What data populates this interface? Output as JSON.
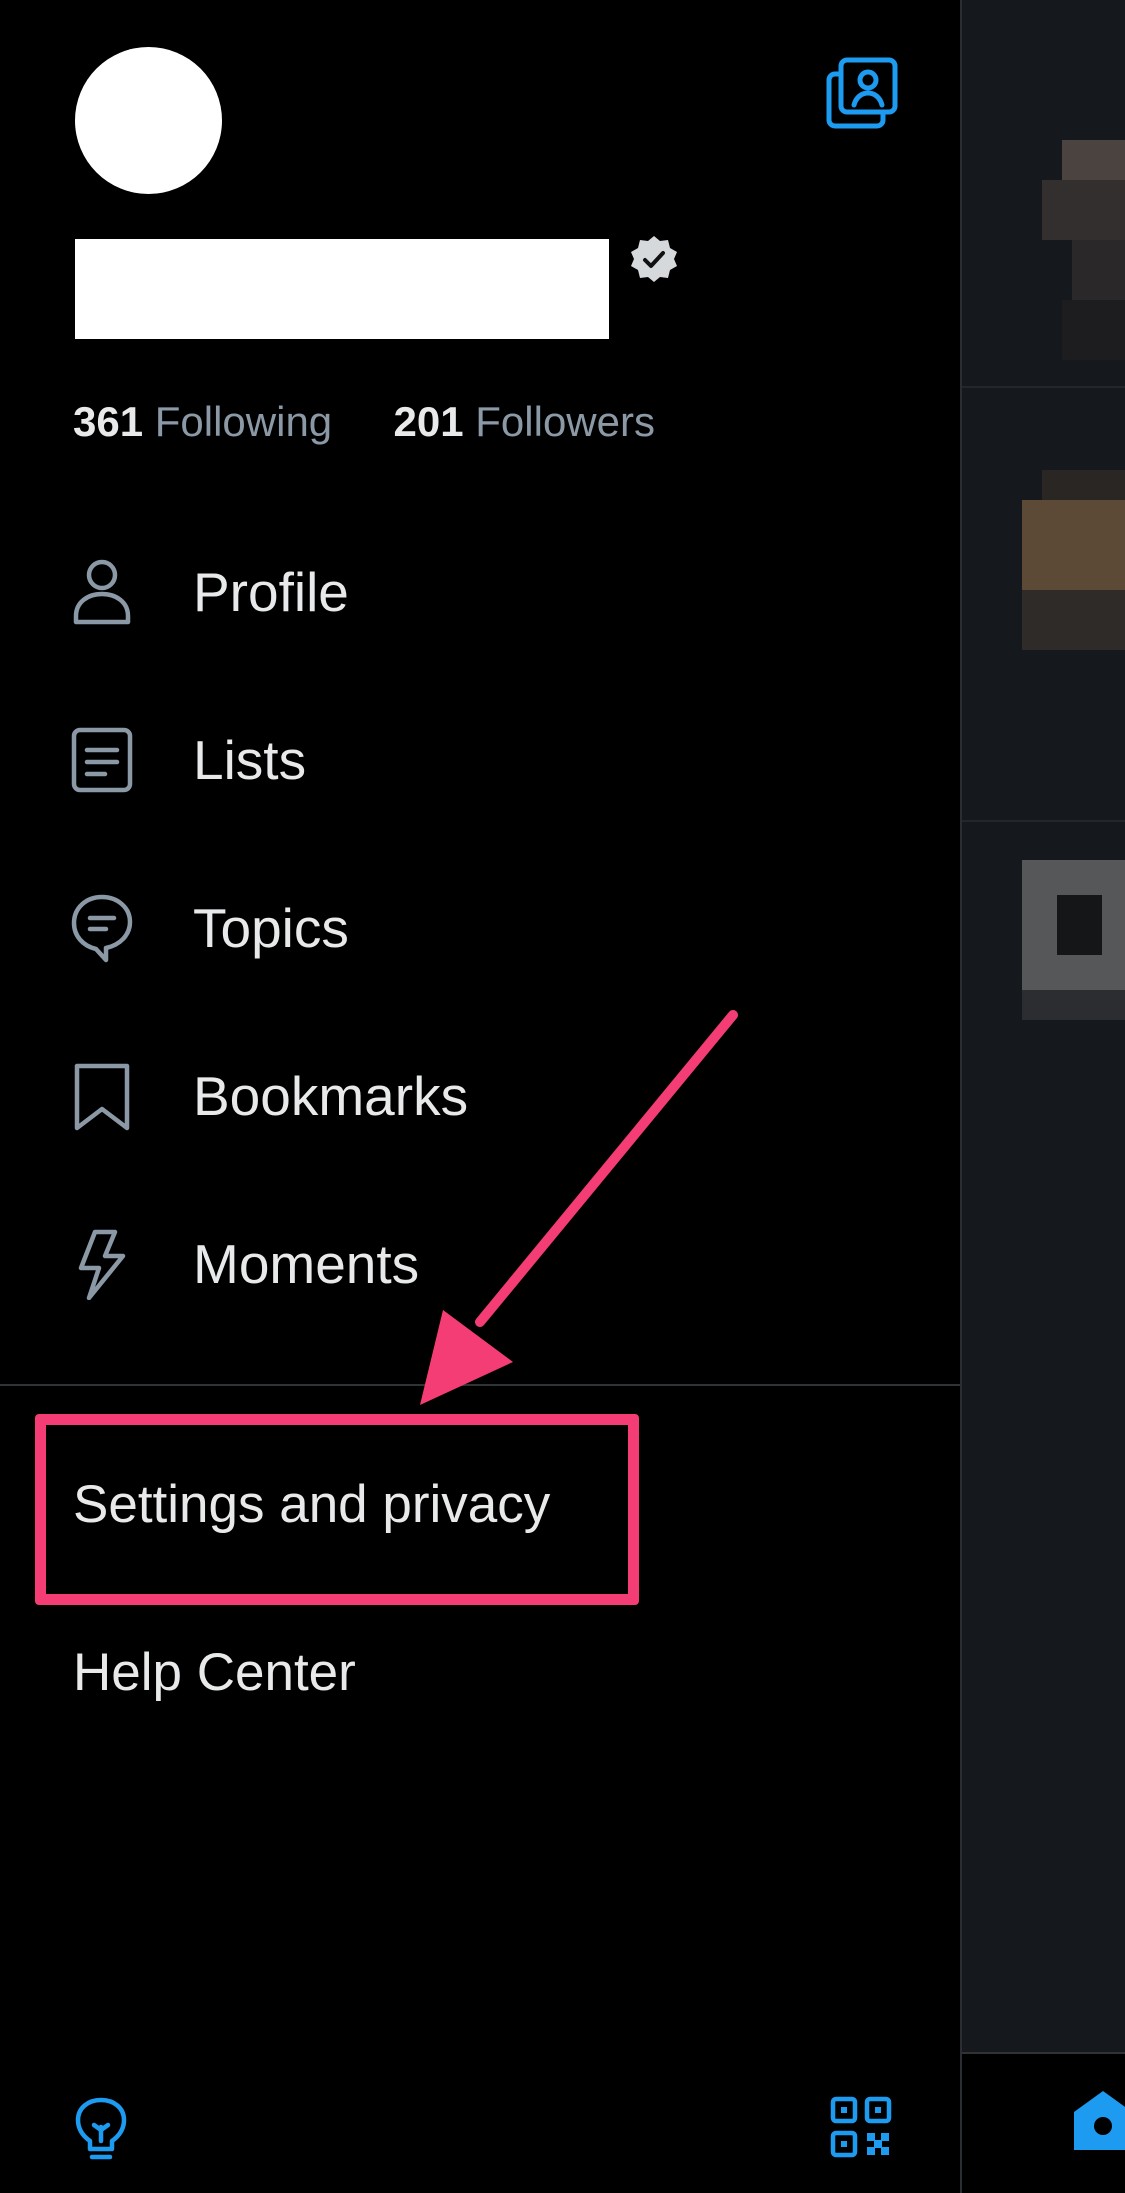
{
  "profile": {
    "following_count": "361",
    "following_label": "Following",
    "followers_count": "201",
    "followers_label": "Followers"
  },
  "menu": {
    "items": [
      {
        "label": "Profile",
        "icon": "person-icon"
      },
      {
        "label": "Lists",
        "icon": "list-icon"
      },
      {
        "label": "Topics",
        "icon": "topics-icon"
      },
      {
        "label": "Bookmarks",
        "icon": "bookmark-icon"
      },
      {
        "label": "Moments",
        "icon": "lightning-icon"
      }
    ],
    "settings_label": "Settings and privacy",
    "help_label": "Help Center"
  },
  "bottom": {
    "left_icon": "lightbulb-icon",
    "right_icon": "qr-code-icon"
  },
  "colors": {
    "accent": "#1d9bf0",
    "text": "#e7e9ea",
    "muted": "#8b98a5",
    "annotation": "#f43d74"
  }
}
